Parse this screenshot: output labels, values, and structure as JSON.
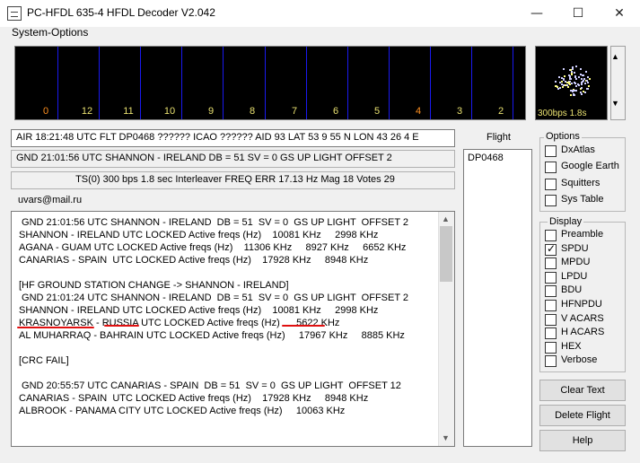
{
  "window": {
    "title": "PC-HFDL 635-4 HFDL Decoder V2.042",
    "minimize_glyph": "—",
    "maximize_glyph": "☐",
    "close_glyph": "✕"
  },
  "menu": {
    "system_options": "System-Options"
  },
  "spectrum": {
    "channel_labels": [
      "0",
      "12",
      "11",
      "10",
      "9",
      "8",
      "7",
      "6",
      "5",
      "4",
      "3",
      "2"
    ],
    "highlight_color": "#ff9020",
    "label_color": "#e8e070",
    "line_color": "#1a1af0"
  },
  "constellation": {
    "label": "300bps 1.8s",
    "icon": "constellation-plot"
  },
  "status": {
    "air_line": "AIR 18:21:48  UTC FLT DP0468 ?????? ICAO ?????? AID 93 LAT 53 9 55  N  LON 43 26 4  E",
    "gnd_line": "GND 21:01:56 UTC SHANNON - IRELAND  DB = 51  SV = 0  GS UP LIGHT  OFFSET 2",
    "ts_line": "TS(0) 300  bps 1.8 sec Interleaver FREQ ERR 17.13 Hz Mag 18 Votes 29"
  },
  "email": "uvars@mail.ru",
  "log": {
    "lines": [
      " GND 21:01:56 UTC SHANNON - IRELAND  DB = 51  SV = 0  GS UP LIGHT  OFFSET 2",
      "SHANNON - IRELAND UTC LOCKED Active freqs (Hz)    10081 KHz     2998 KHz",
      "AGANA - GUAM UTC LOCKED Active freqs (Hz)    11306 KHz     8927 KHz     6652 KHz",
      "CANARIAS - SPAIN  UTC LOCKED Active freqs (Hz)    17928 KHz     8948 KHz",
      "",
      "[HF GROUND STATION CHANGE -> SHANNON - IRELAND]",
      " GND 21:01:24 UTC SHANNON - IRELAND  DB = 51  SV = 0  GS UP LIGHT  OFFSET 2",
      "SHANNON - IRELAND UTC LOCKED Active freqs (Hz)    10081 KHz     2998 KHz",
      "KRASNOYARSK - RUSSIA UTC LOCKED Active freqs (Hz)      5622 KHz",
      "AL MUHARRAQ - BAHRAIN UTC LOCKED Active freqs (Hz)     17967 KHz     8885 KHz",
      "",
      "[CRC FAIL]",
      "",
      " GND 20:55:57 UTC CANARIAS - SPAIN  DB = 51  SV = 0  GS UP LIGHT  OFFSET 12",
      "CANARIAS - SPAIN  UTC LOCKED Active freqs (Hz)    17928 KHz     8948 KHz",
      "ALBROOK - PANAMA CITY UTC LOCKED Active freqs (Hz)     10063 KHz"
    ],
    "scroll_up_glyph": "▲",
    "scroll_down_glyph": "▼"
  },
  "flight": {
    "label": "Flight",
    "items": [
      "DP0468"
    ]
  },
  "options": {
    "title": "Options",
    "items": [
      {
        "label": "DxAtlas",
        "checked": false
      },
      {
        "label": "Google Earth",
        "checked": false
      },
      {
        "label": "Squitters",
        "checked": false
      },
      {
        "label": "Sys Table",
        "checked": false
      }
    ]
  },
  "display": {
    "title": "Display",
    "items": [
      {
        "label": "Preamble",
        "checked": false
      },
      {
        "label": "SPDU",
        "checked": true
      },
      {
        "label": "MPDU",
        "checked": false
      },
      {
        "label": "LPDU",
        "checked": false
      },
      {
        "label": "BDU",
        "checked": false
      },
      {
        "label": "HFNPDU",
        "checked": false
      },
      {
        "label": "V ACARS",
        "checked": false
      },
      {
        "label": "H ACARS",
        "checked": false
      },
      {
        "label": "HEX",
        "checked": false
      },
      {
        "label": "Verbose",
        "checked": false
      }
    ]
  },
  "buttons": {
    "clear_text": "Clear Text",
    "delete_flight": "Delete Flight",
    "help": "Help"
  },
  "spin": {
    "up_glyph": "▲",
    "down_glyph": "▼"
  }
}
